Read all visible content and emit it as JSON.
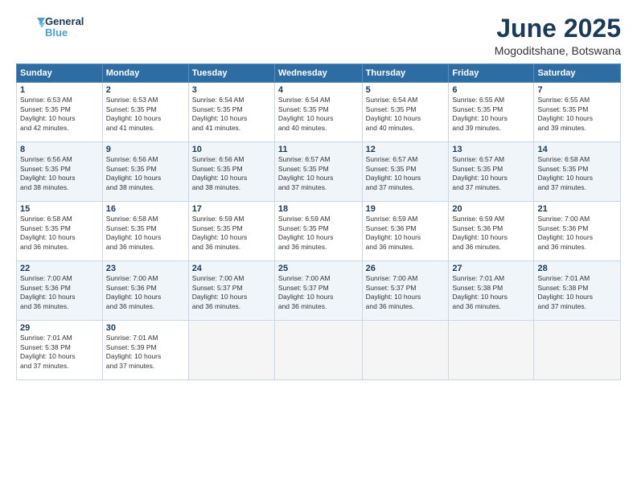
{
  "header": {
    "logo_line1": "General",
    "logo_line2": "Blue",
    "month_title": "June 2025",
    "location": "Mogoditshane, Botswana"
  },
  "days_of_week": [
    "Sunday",
    "Monday",
    "Tuesday",
    "Wednesday",
    "Thursday",
    "Friday",
    "Saturday"
  ],
  "weeks": [
    [
      {
        "day": "1",
        "info": "Sunrise: 6:53 AM\nSunset: 5:35 PM\nDaylight: 10 hours\nand 42 minutes."
      },
      {
        "day": "2",
        "info": "Sunrise: 6:53 AM\nSunset: 5:35 PM\nDaylight: 10 hours\nand 41 minutes."
      },
      {
        "day": "3",
        "info": "Sunrise: 6:54 AM\nSunset: 5:35 PM\nDaylight: 10 hours\nand 41 minutes."
      },
      {
        "day": "4",
        "info": "Sunrise: 6:54 AM\nSunset: 5:35 PM\nDaylight: 10 hours\nand 40 minutes."
      },
      {
        "day": "5",
        "info": "Sunrise: 6:54 AM\nSunset: 5:35 PM\nDaylight: 10 hours\nand 40 minutes."
      },
      {
        "day": "6",
        "info": "Sunrise: 6:55 AM\nSunset: 5:35 PM\nDaylight: 10 hours\nand 39 minutes."
      },
      {
        "day": "7",
        "info": "Sunrise: 6:55 AM\nSunset: 5:35 PM\nDaylight: 10 hours\nand 39 minutes."
      }
    ],
    [
      {
        "day": "8",
        "info": "Sunrise: 6:56 AM\nSunset: 5:35 PM\nDaylight: 10 hours\nand 38 minutes."
      },
      {
        "day": "9",
        "info": "Sunrise: 6:56 AM\nSunset: 5:35 PM\nDaylight: 10 hours\nand 38 minutes."
      },
      {
        "day": "10",
        "info": "Sunrise: 6:56 AM\nSunset: 5:35 PM\nDaylight: 10 hours\nand 38 minutes."
      },
      {
        "day": "11",
        "info": "Sunrise: 6:57 AM\nSunset: 5:35 PM\nDaylight: 10 hours\nand 37 minutes."
      },
      {
        "day": "12",
        "info": "Sunrise: 6:57 AM\nSunset: 5:35 PM\nDaylight: 10 hours\nand 37 minutes."
      },
      {
        "day": "13",
        "info": "Sunrise: 6:57 AM\nSunset: 5:35 PM\nDaylight: 10 hours\nand 37 minutes."
      },
      {
        "day": "14",
        "info": "Sunrise: 6:58 AM\nSunset: 5:35 PM\nDaylight: 10 hours\nand 37 minutes."
      }
    ],
    [
      {
        "day": "15",
        "info": "Sunrise: 6:58 AM\nSunset: 5:35 PM\nDaylight: 10 hours\nand 36 minutes."
      },
      {
        "day": "16",
        "info": "Sunrise: 6:58 AM\nSunset: 5:35 PM\nDaylight: 10 hours\nand 36 minutes."
      },
      {
        "day": "17",
        "info": "Sunrise: 6:59 AM\nSunset: 5:35 PM\nDaylight: 10 hours\nand 36 minutes."
      },
      {
        "day": "18",
        "info": "Sunrise: 6:59 AM\nSunset: 5:35 PM\nDaylight: 10 hours\nand 36 minutes."
      },
      {
        "day": "19",
        "info": "Sunrise: 6:59 AM\nSunset: 5:36 PM\nDaylight: 10 hours\nand 36 minutes."
      },
      {
        "day": "20",
        "info": "Sunrise: 6:59 AM\nSunset: 5:36 PM\nDaylight: 10 hours\nand 36 minutes."
      },
      {
        "day": "21",
        "info": "Sunrise: 7:00 AM\nSunset: 5:36 PM\nDaylight: 10 hours\nand 36 minutes."
      }
    ],
    [
      {
        "day": "22",
        "info": "Sunrise: 7:00 AM\nSunset: 5:36 PM\nDaylight: 10 hours\nand 36 minutes."
      },
      {
        "day": "23",
        "info": "Sunrise: 7:00 AM\nSunset: 5:36 PM\nDaylight: 10 hours\nand 36 minutes."
      },
      {
        "day": "24",
        "info": "Sunrise: 7:00 AM\nSunset: 5:37 PM\nDaylight: 10 hours\nand 36 minutes."
      },
      {
        "day": "25",
        "info": "Sunrise: 7:00 AM\nSunset: 5:37 PM\nDaylight: 10 hours\nand 36 minutes."
      },
      {
        "day": "26",
        "info": "Sunrise: 7:00 AM\nSunset: 5:37 PM\nDaylight: 10 hours\nand 36 minutes."
      },
      {
        "day": "27",
        "info": "Sunrise: 7:01 AM\nSunset: 5:38 PM\nDaylight: 10 hours\nand 36 minutes."
      },
      {
        "day": "28",
        "info": "Sunrise: 7:01 AM\nSunset: 5:38 PM\nDaylight: 10 hours\nand 37 minutes."
      }
    ],
    [
      {
        "day": "29",
        "info": "Sunrise: 7:01 AM\nSunset: 5:38 PM\nDaylight: 10 hours\nand 37 minutes."
      },
      {
        "day": "30",
        "info": "Sunrise: 7:01 AM\nSunset: 5:39 PM\nDaylight: 10 hours\nand 37 minutes."
      },
      {
        "day": "",
        "info": ""
      },
      {
        "day": "",
        "info": ""
      },
      {
        "day": "",
        "info": ""
      },
      {
        "day": "",
        "info": ""
      },
      {
        "day": "",
        "info": ""
      }
    ]
  ]
}
